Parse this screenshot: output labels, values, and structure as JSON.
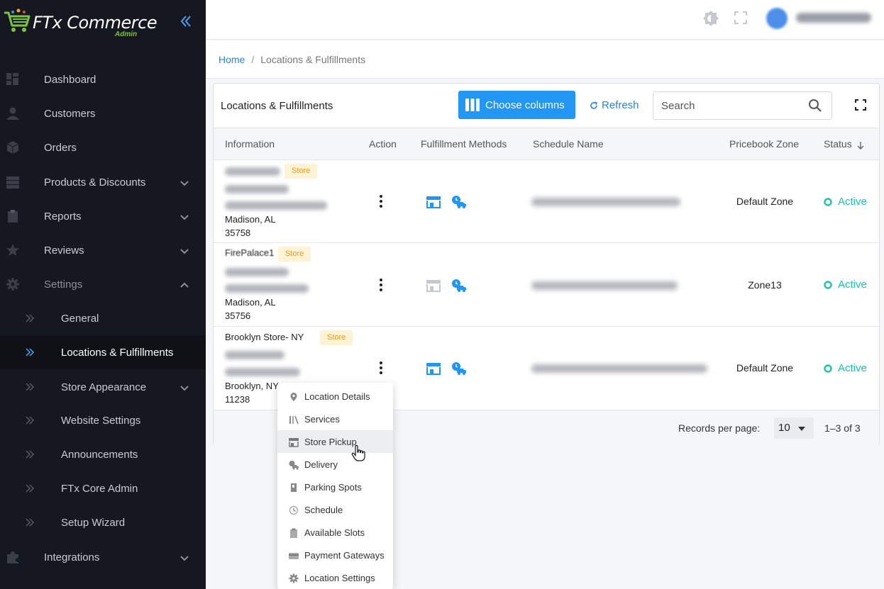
{
  "app": {
    "logo_text": "FTx Commerce",
    "logo_sub": "Admin"
  },
  "sidebar": {
    "items": [
      {
        "label": "Dashboard",
        "icon": "dashboard-icon"
      },
      {
        "label": "Customers",
        "icon": "user-icon"
      },
      {
        "label": "Orders",
        "icon": "box-icon"
      },
      {
        "label": "Products & Discounts",
        "icon": "server-icon"
      },
      {
        "label": "Reports",
        "icon": "clipboard-icon"
      },
      {
        "label": "Reviews",
        "icon": "star-icon"
      },
      {
        "label": "Settings",
        "icon": "gear-icon"
      }
    ],
    "settings_sub": [
      {
        "label": "General"
      },
      {
        "label": "Locations & Fulfillments"
      },
      {
        "label": "Store Appearance"
      },
      {
        "label": "Website Settings"
      },
      {
        "label": "Announcements"
      },
      {
        "label": "FTx Core Admin"
      },
      {
        "label": "Setup Wizard"
      }
    ],
    "integrations": {
      "label": "Integrations",
      "icon": "puzzle-icon"
    }
  },
  "breadcrumb": {
    "home": "Home",
    "separator": "/",
    "current": "Locations & Fulfillments"
  },
  "card": {
    "title": "Locations & Fulfillments",
    "choose_columns": "Choose columns",
    "refresh": "Refresh",
    "search_placeholder": "Search"
  },
  "table": {
    "headers": {
      "information": "Information",
      "action": "Action",
      "fulfillment": "Fulfillment Methods",
      "schedule": "Schedule Name",
      "pricebook": "Pricebook Zone",
      "status": "Status"
    },
    "rows": [
      {
        "name": "",
        "badge": "Store",
        "city": "Madison, AL",
        "zip": "35758",
        "zone": "Default Zone",
        "status": "Active",
        "pickup_enabled": true
      },
      {
        "name": "FirePalace1",
        "badge": "Store",
        "city": "Madison, AL",
        "zip": "35756",
        "zone": "Zone13",
        "status": "Active",
        "pickup_enabled": false
      },
      {
        "name": "Brooklyn Store- NY",
        "badge": "Store",
        "city": "Brooklyn, NY",
        "zip": "11238",
        "zone": "Default Zone",
        "status": "Active",
        "pickup_enabled": true
      }
    ]
  },
  "pagination": {
    "label": "Records per page:",
    "value": "10",
    "range": "1–3 of 3"
  },
  "action_menu": {
    "items": [
      {
        "label": "Location Details",
        "icon": "pin-icon"
      },
      {
        "label": "Services",
        "icon": "services-icon"
      },
      {
        "label": "Store Pickup",
        "icon": "store-icon"
      },
      {
        "label": "Delivery",
        "icon": "delivery-icon"
      },
      {
        "label": "Parking Spots",
        "icon": "parking-icon"
      },
      {
        "label": "Schedule",
        "icon": "clock-icon"
      },
      {
        "label": "Available Slots",
        "icon": "clipboard-icon"
      },
      {
        "label": "Payment Gateways",
        "icon": "card-icon"
      },
      {
        "label": "Location Settings",
        "icon": "gear-icon"
      }
    ]
  },
  "colors": {
    "accent": "#2196f3",
    "sidebar": "#151821",
    "active": "#1ec2a8",
    "badge": "#e89a1a"
  }
}
